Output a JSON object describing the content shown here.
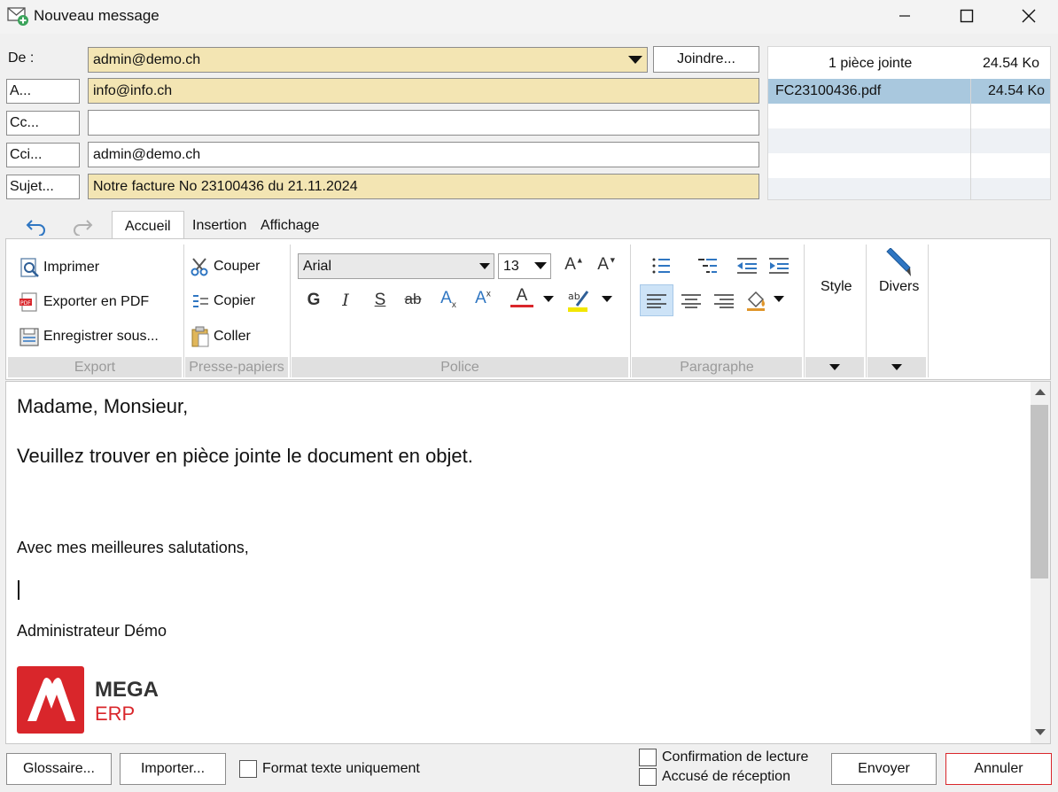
{
  "window": {
    "title": "Nouveau message",
    "icon": "mail-add-icon",
    "controls": [
      "minimize-icon",
      "maximize-icon",
      "close-icon"
    ]
  },
  "header": {
    "from_label": "De :",
    "from_value": "admin@demo.ch",
    "attach_button": "Joindre...",
    "to_button": "A...",
    "to_value": "info@info.ch",
    "cc_button": "Cc...",
    "cc_value": "",
    "bcc_button": "Cci...",
    "bcc_value": "admin@demo.ch",
    "subject_button": "Sujet...",
    "subject_value": "Notre facture No 23100436 du 21.11.2024"
  },
  "attachments": {
    "summary_label": "1 pièce jointe",
    "summary_size": "24.54 Ko",
    "items": [
      {
        "name": "FC23100436.pdf",
        "size": "24.54 Ko"
      }
    ]
  },
  "ribbon": {
    "tabs": [
      "Accueil",
      "Insertion",
      "Affichage"
    ],
    "active_tab": "Accueil",
    "export": {
      "print": "Imprimer",
      "export_pdf": "Exporter en PDF",
      "save_as": "Enregistrer sous...",
      "group_label": "Export"
    },
    "clipboard": {
      "cut": "Couper",
      "copy": "Copier",
      "paste": "Coller",
      "group_label": "Presse-papiers"
    },
    "font": {
      "family": "Arial",
      "size": "13",
      "bold": "G",
      "italic": "I",
      "underline": "S",
      "strike": "ab",
      "subscript": "A",
      "superscript": "A",
      "color": "A",
      "group_label": "Police"
    },
    "paragraph": {
      "group_label": "Paragraphe"
    },
    "style": {
      "label": "Style"
    },
    "misc": {
      "label": "Divers"
    }
  },
  "body": {
    "greeting": "Madame, Monsieur,",
    "line1": "Veuillez trouver en pièce jointe le document en objet.",
    "closing": "Avec mes meilleures salutations,",
    "signature": "Administrateur Démo",
    "logo_line1": "MEGA",
    "logo_line2": "ERP"
  },
  "footer": {
    "glossary_button": "Glossaire...",
    "import_button": "Importer...",
    "plain_text_label": "Format texte uniquement",
    "read_receipt_label": "Confirmation de lecture",
    "delivery_receipt_label": "Accusé de réception",
    "send_button": "Envoyer",
    "cancel_button": "Annuler"
  },
  "colors": {
    "field_highlight": "#f3e5b3",
    "selected_row": "#a9c8de",
    "logo_red": "#d9262b",
    "cancel_border": "#d9262b"
  }
}
